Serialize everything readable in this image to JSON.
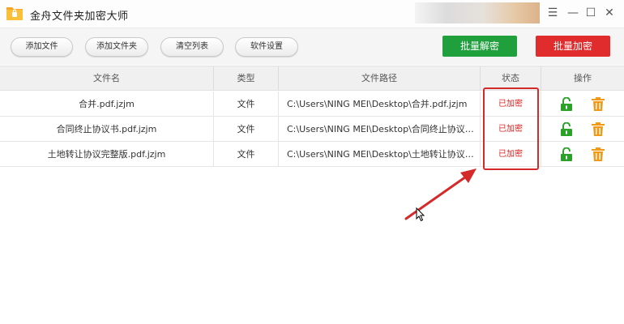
{
  "window": {
    "title": "金舟文件夹加密大师",
    "controls": [
      "☰",
      "—",
      "☐",
      "✕"
    ]
  },
  "toolbar": {
    "add_file": "添加文件",
    "add_folder": "添加文件夹",
    "clear_list": "清空列表",
    "settings": "软件设置",
    "batch_decrypt": "批量解密",
    "batch_encrypt": "批量加密"
  },
  "table": {
    "headers": {
      "name": "文件名",
      "type": "类型",
      "path": "文件路径",
      "status": "状态",
      "ops": "操作"
    },
    "rows": [
      {
        "name": "合并.pdf.jzjm",
        "type": "文件",
        "path": "C:\\Users\\NING MEI\\Desktop\\合并.pdf.jzjm",
        "status": "已加密"
      },
      {
        "name": "合同终止协议书.pdf.jzjm",
        "type": "文件",
        "path": "C:\\Users\\NING MEI\\Desktop\\合同终止协议书....",
        "status": "已加密"
      },
      {
        "name": "土地转让协议完整版.pdf.jzjm",
        "type": "文件",
        "path": "C:\\Users\\NING MEI\\Desktop\\土地转让协议完...",
        "status": "已加密"
      }
    ]
  },
  "colors": {
    "green": "#1fa03d",
    "red": "#e02c2c",
    "status_red": "#e02020",
    "unlock_green": "#2aa22a",
    "delete_orange": "#f29a17",
    "annotation_red": "#d42a2a"
  },
  "icons": {
    "app": "folder-lock-icon",
    "unlock": "unlock-icon",
    "delete": "trash-icon",
    "cursor": "mouse-cursor-icon"
  }
}
